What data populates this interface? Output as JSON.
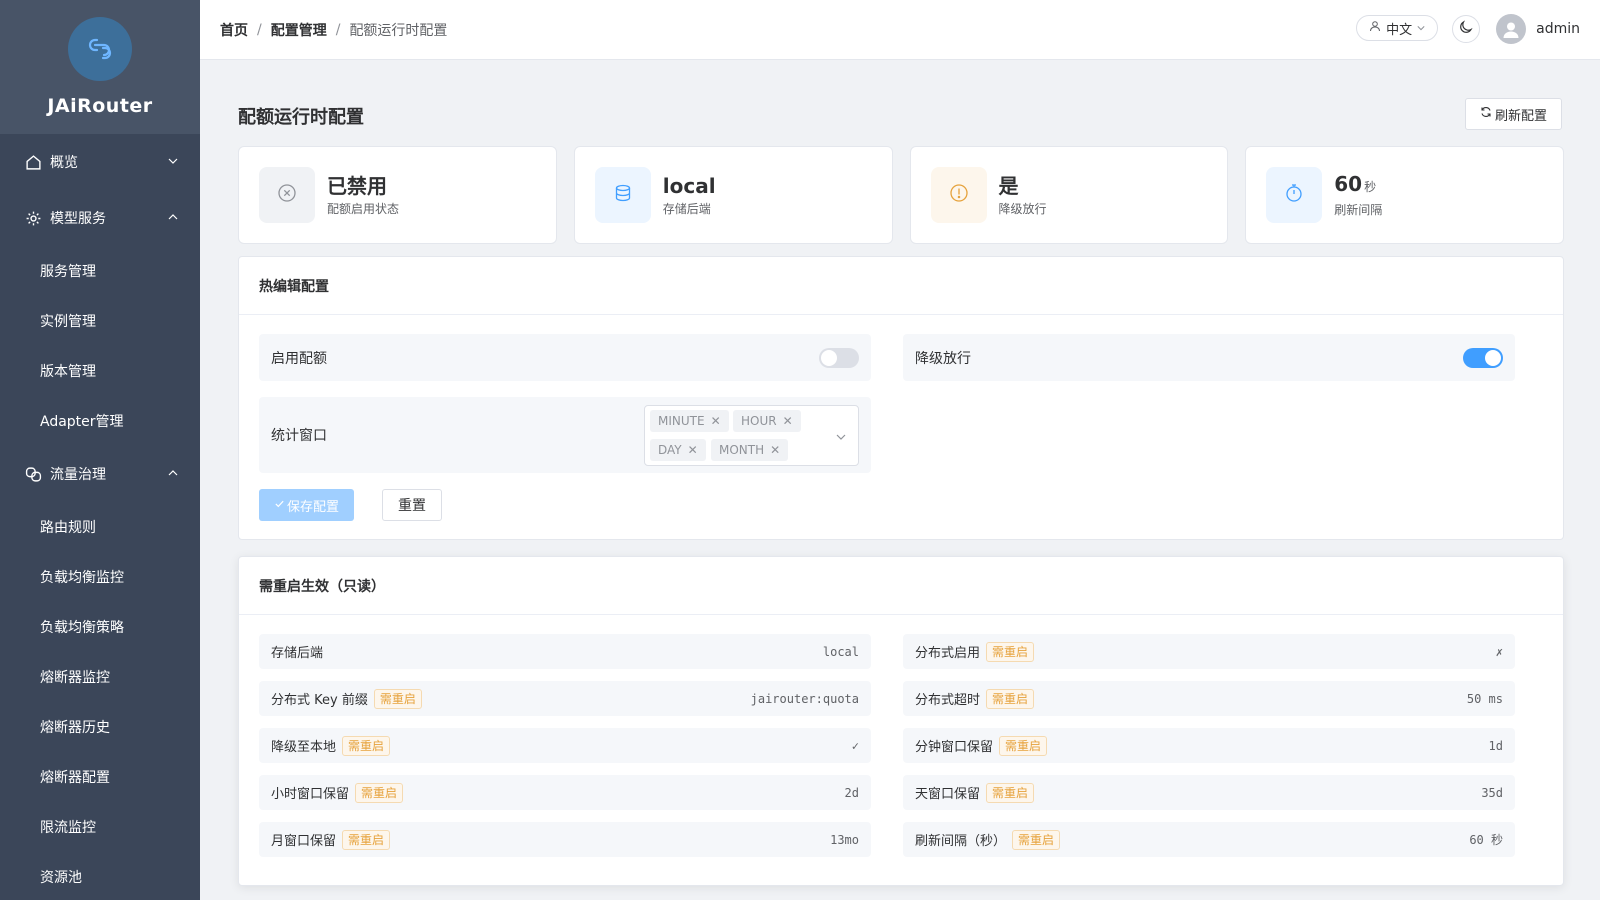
{
  "app": {
    "name": "JAiRouter"
  },
  "sidebar": {
    "groups": [
      {
        "label": "概览",
        "icon": "home-icon",
        "expanded": false
      },
      {
        "label": "模型服务",
        "icon": "gear-icon",
        "expanded": true,
        "items": [
          "服务管理",
          "实例管理",
          "版本管理",
          "Adapter管理"
        ]
      },
      {
        "label": "流量治理",
        "icon": "link-icon",
        "expanded": true,
        "items": [
          "路由规则",
          "负载均衡监控",
          "负载均衡策略",
          "熔断器监控",
          "熔断器历史",
          "熔断器配置",
          "限流监控",
          "资源池"
        ]
      }
    ]
  },
  "header": {
    "breadcrumb": [
      "首页",
      "配置管理",
      "配额运行时配置"
    ],
    "separator": "/",
    "language": "中文",
    "username": "admin"
  },
  "page": {
    "title": "配额运行时配置",
    "refresh_label": "刷新配置"
  },
  "stats": [
    {
      "value": "已禁用",
      "unit": "",
      "label": "配额启用状态",
      "icon": "circle-x-icon",
      "color": "#909399",
      "bg": "#f0f2f5"
    },
    {
      "value": "local",
      "unit": "",
      "label": "存储后端",
      "icon": "database-icon",
      "color": "#409eff",
      "bg": "#ecf5ff"
    },
    {
      "value": "是",
      "unit": "",
      "label": "降级放行",
      "icon": "warning-icon",
      "color": "#e6a23c",
      "bg": "#fdf6ec"
    },
    {
      "value": "60",
      "unit": "秒",
      "label": "刷新间隔",
      "icon": "timer-icon",
      "color": "#409eff",
      "bg": "#ecf5ff"
    }
  ],
  "hot_edit": {
    "title": "热编辑配置",
    "enable_quota": {
      "label": "启用配额",
      "on": false
    },
    "degrade_pass": {
      "label": "降级放行",
      "on": true
    },
    "window": {
      "label": "统计窗口",
      "tags": [
        "MINUTE",
        "HOUR",
        "DAY",
        "MONTH"
      ]
    },
    "save_label": "保存配置",
    "reset_label": "重置"
  },
  "readonly": {
    "title": "需重启生效（只读）",
    "badge_label": "需重启",
    "items": [
      {
        "label": "存储后端",
        "value": "local",
        "badge": false
      },
      {
        "label": "分布式启用",
        "value": "✗",
        "badge": true
      },
      {
        "label": "分布式 Key 前缀",
        "value": "jairouter:quota",
        "badge": true
      },
      {
        "label": "分布式超时",
        "value": "50 ms",
        "badge": true
      },
      {
        "label": "降级至本地",
        "value": "✓",
        "badge": true
      },
      {
        "label": "分钟窗口保留",
        "value": "1d",
        "badge": true
      },
      {
        "label": "小时窗口保留",
        "value": "2d",
        "badge": true
      },
      {
        "label": "天窗口保留",
        "value": "35d",
        "badge": true
      },
      {
        "label": "月窗口保留",
        "value": "13mo",
        "badge": true
      },
      {
        "label": "刷新间隔（秒）",
        "value": "60 秒",
        "badge": true
      }
    ]
  }
}
